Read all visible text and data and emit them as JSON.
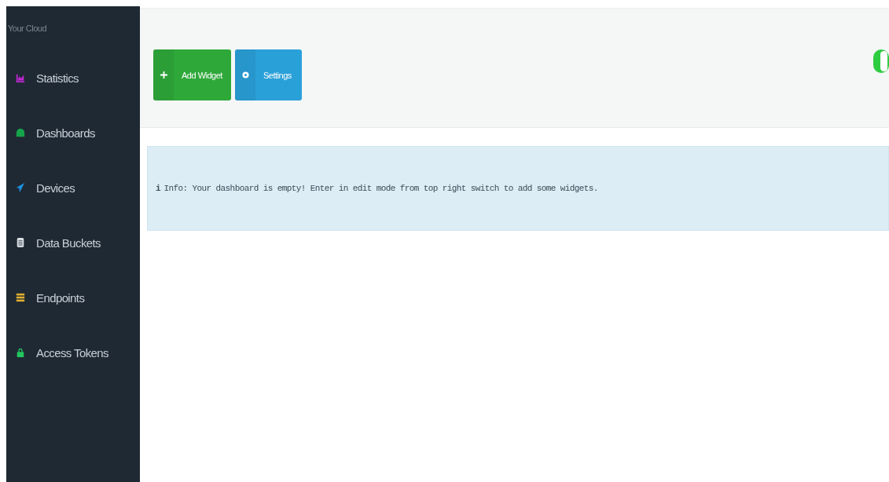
{
  "sidebar": {
    "brand": "Your Cloud",
    "items": [
      {
        "label": "Statistics",
        "kind": "chart",
        "color": "#c026d3",
        "selected": false
      },
      {
        "label": "Dashboards",
        "kind": "cloud",
        "color": "#16a34a",
        "selected": false
      },
      {
        "label": "Devices",
        "kind": "rocket",
        "color": "#1e90e0",
        "selected": false
      },
      {
        "label": "Data Buckets",
        "kind": "database",
        "color": "#d8dde2",
        "selected": false
      },
      {
        "label": "Endpoints",
        "kind": "server",
        "color": "#e0b030",
        "selected": false
      },
      {
        "label": "Access Tokens",
        "kind": "lock",
        "color": "#22c55e",
        "selected": false
      }
    ]
  },
  "toolbar": {
    "buttons": [
      {
        "label": "Add Widget",
        "kind": "add"
      },
      {
        "label": "Settings",
        "kind": "settings"
      }
    ],
    "edit_switch": {
      "on": true
    }
  },
  "alert": {
    "icon": "i",
    "text": "Info: Your dashboard is empty! Enter in edit mode from top right switch to add some widgets."
  }
}
